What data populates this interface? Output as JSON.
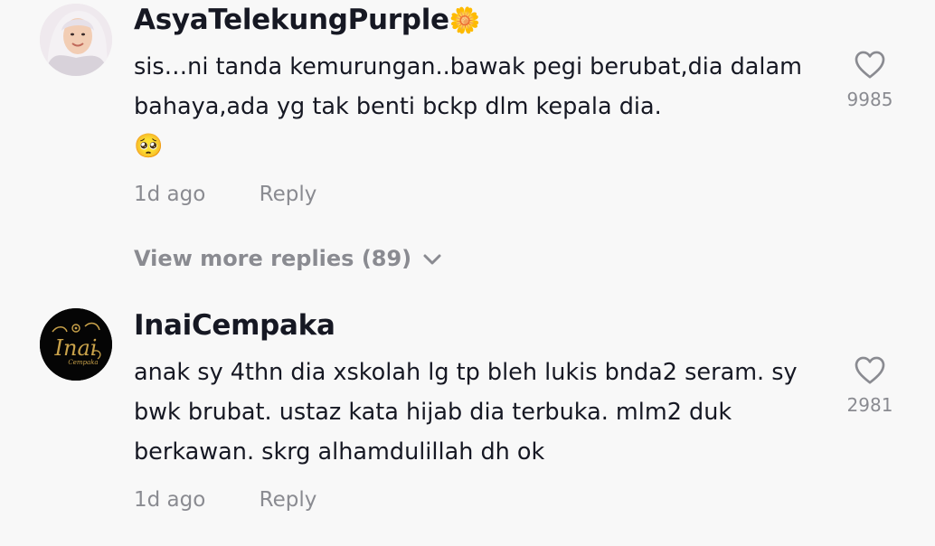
{
  "comments": [
    {
      "username": "AsyaTelekungPurple",
      "username_emoji": "🌼",
      "text": "sis…ni tanda kemurungan..bawak pegi berubat,dia dalam bahaya,ada yg tak benti bckp dlm kepala dia.",
      "text_emoji": "🥺",
      "time": "1d ago",
      "reply_label": "Reply",
      "like_count": "9985",
      "avatar_icon": "woman-hijab-avatar"
    },
    {
      "username": "InaiCempaka",
      "text": "anak sy 4thn dia xskolah lg tp bleh lukis bnda2 seram. sy bwk brubat. ustaz kata hijab dia terbuka. mlm2 duk berkawan. skrg alhamdulillah dh ok",
      "time": "1d ago",
      "reply_label": "Reply",
      "like_count": "2981",
      "avatar_logo_text": "Inai",
      "avatar_logo_subtext": "Cempaka"
    }
  ],
  "view_more_replies": "View more replies (89)",
  "colors": {
    "primary_text": "#161823",
    "secondary_text": "#8a8b91",
    "background": "#f8f8f8",
    "logo_gold": "#c9a24a"
  }
}
